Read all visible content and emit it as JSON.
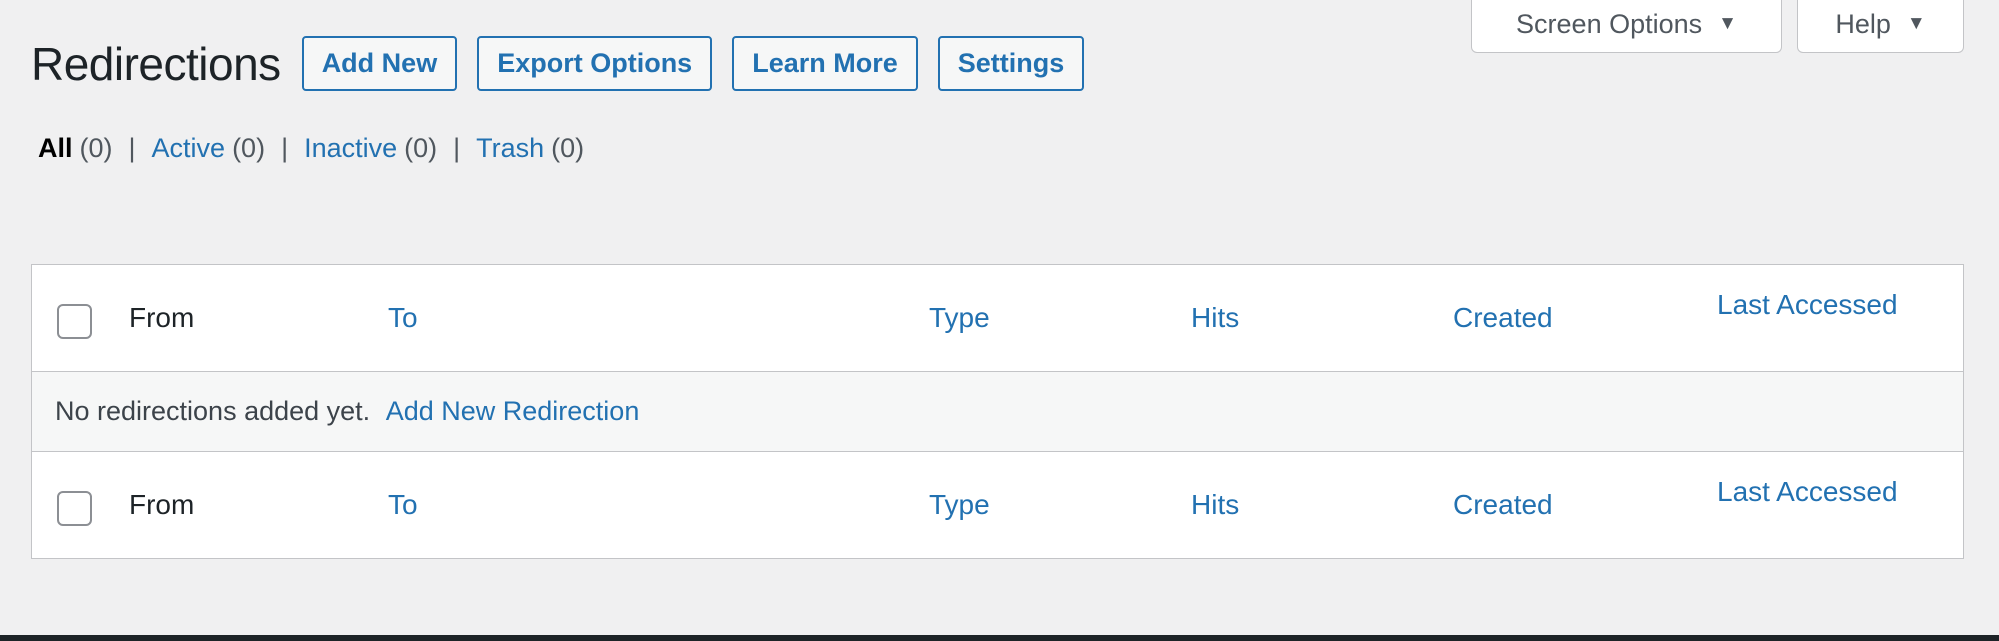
{
  "header": {
    "title": "Redirections",
    "buttons": [
      {
        "label": "Add New"
      },
      {
        "label": "Export Options"
      },
      {
        "label": "Learn More"
      },
      {
        "label": "Settings"
      }
    ]
  },
  "screen_meta": {
    "screen_options_label": "Screen Options",
    "help_label": "Help",
    "arrow_glyph": "▼"
  },
  "filters": [
    {
      "label": "All",
      "count": "(0)",
      "current": true
    },
    {
      "label": "Active",
      "count": "(0)",
      "current": false
    },
    {
      "label": "Inactive",
      "count": "(0)",
      "current": false
    },
    {
      "label": "Trash",
      "count": "(0)",
      "current": false
    }
  ],
  "filter_separator": "|",
  "table": {
    "columns": [
      {
        "label": "From",
        "sortable": false
      },
      {
        "label": "To",
        "sortable": true
      },
      {
        "label": "Type",
        "sortable": true
      },
      {
        "label": "Hits",
        "sortable": true
      },
      {
        "label": "Created",
        "sortable": true
      },
      {
        "label": "Last Accessed",
        "sortable": true
      }
    ],
    "empty_message": "No redirections added yet.",
    "empty_link": "Add New Redirection"
  },
  "colors": {
    "link": "#2271b1",
    "text": "#1d2327",
    "background": "#f0f0f1",
    "border": "#c3c4c7"
  }
}
